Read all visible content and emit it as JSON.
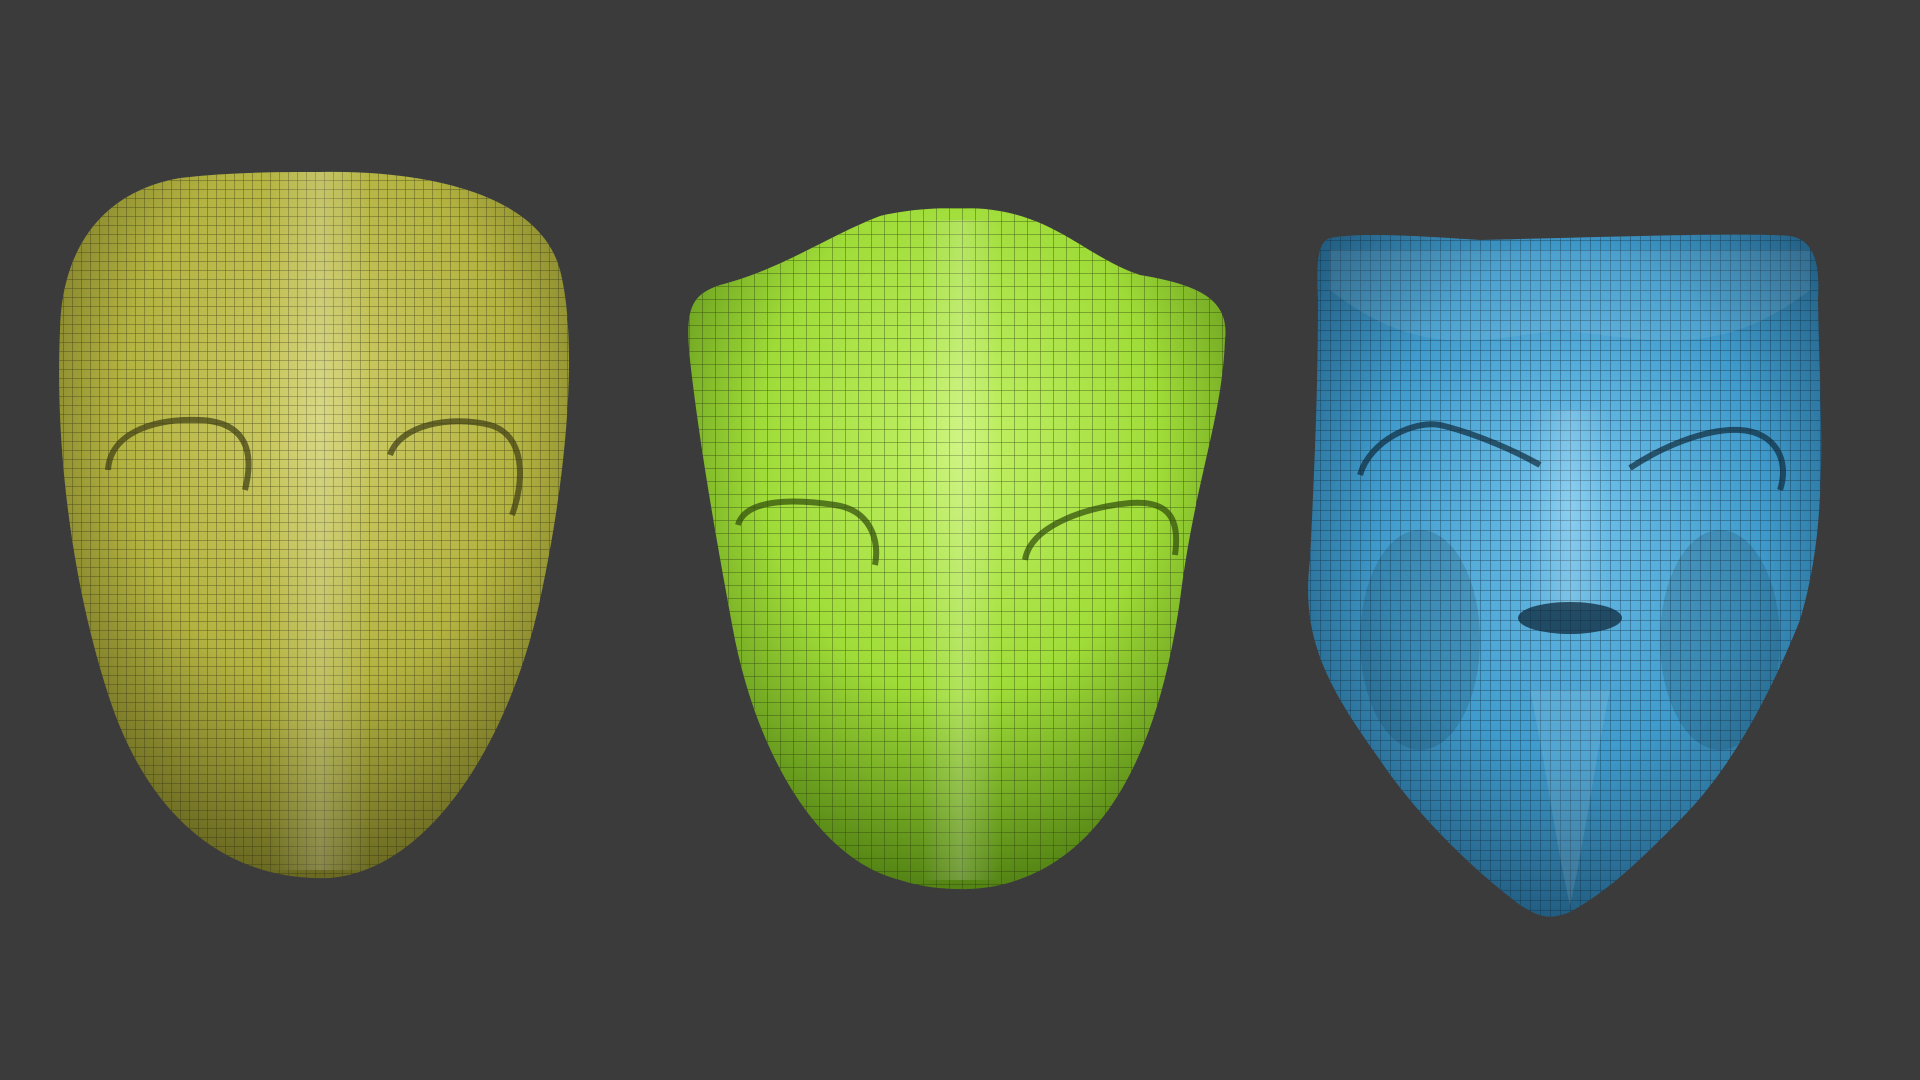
{
  "scene": {
    "background_color": "#3b3b3c",
    "masks": [
      {
        "name": "mask-olive",
        "base_color": "#b3b341",
        "light_color": "#d0cf6a",
        "dark_color": "#6e6d22",
        "wire_color": "#2e2e12"
      },
      {
        "name": "mask-lime",
        "base_color": "#9fdc38",
        "light_color": "#c4f26a",
        "dark_color": "#5d9018",
        "wire_color": "#25380c"
      },
      {
        "name": "mask-blue",
        "base_color": "#3f9bcc",
        "light_color": "#72c3ec",
        "dark_color": "#1f5a80",
        "wire_color": "#0f2a3c"
      }
    ]
  }
}
